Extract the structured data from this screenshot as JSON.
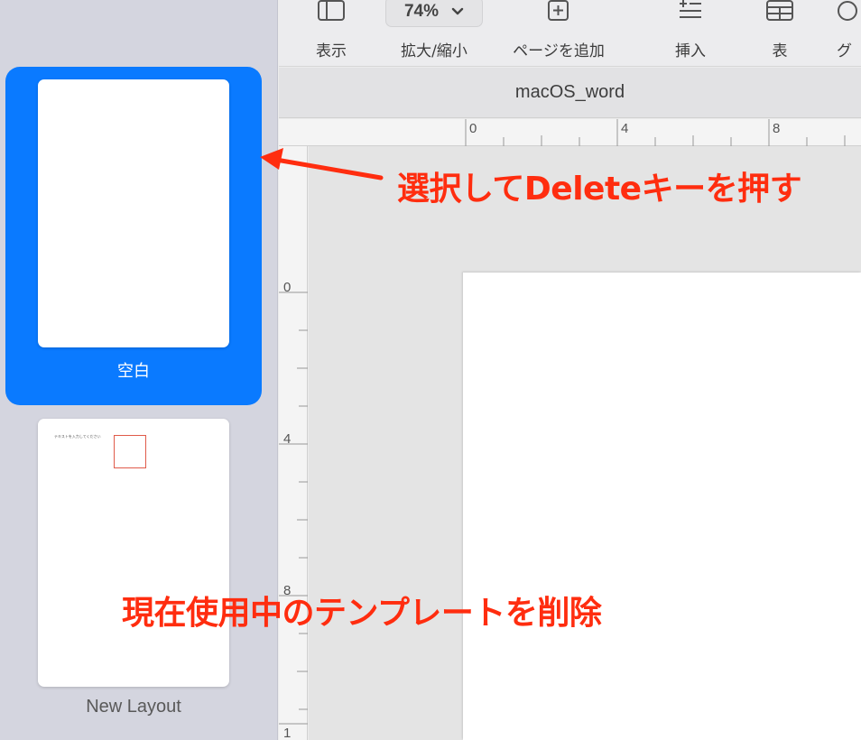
{
  "toolbar": {
    "items": [
      {
        "label": "表示",
        "icon": "sidebar-icon"
      },
      {
        "label": "拡大/縮小",
        "value": "74%",
        "icon": "chevron-down-icon"
      },
      {
        "label": "ページを追加",
        "icon": "plus-square-icon"
      },
      {
        "label": "挿入",
        "icon": "insert-list-icon"
      },
      {
        "label": "表",
        "icon": "table-icon"
      },
      {
        "label": "グ",
        "icon": "chart-icon"
      }
    ]
  },
  "document": {
    "title": "macOS_word"
  },
  "sidebar": {
    "pages": [
      {
        "label": "空白",
        "selected": true
      },
      {
        "label": "New Layout",
        "selected": false,
        "thumb_text": "テキストを入力してください"
      }
    ]
  },
  "rulers": {
    "horizontal": [
      "0",
      "4",
      "8"
    ],
    "vertical": [
      "0",
      "4",
      "8",
      "1"
    ]
  },
  "annotations": {
    "select_and_delete": "選択してDeleteキーを押す",
    "delete_template": "現在使用中のテンプレートを削除"
  },
  "colors": {
    "accent": "#0a7aff",
    "annotation": "#ff2d0f",
    "sidebar_bg": "#d4d5df"
  }
}
